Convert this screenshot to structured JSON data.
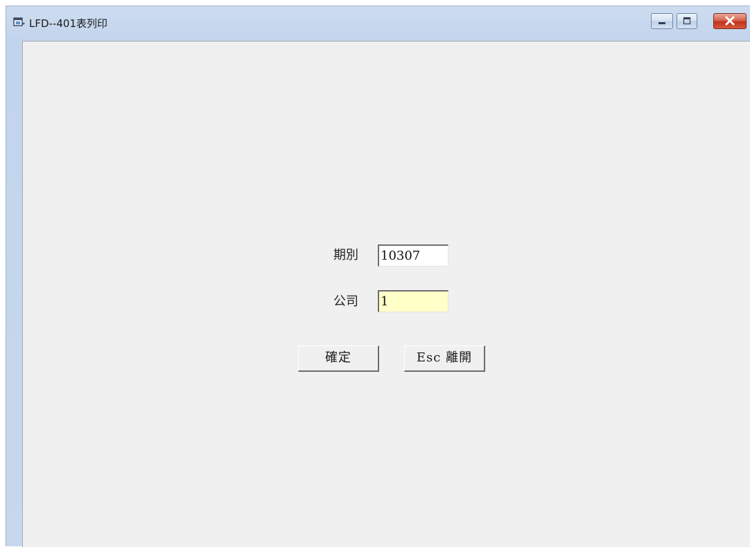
{
  "window": {
    "title": "LFD--401表列印"
  },
  "form": {
    "period": {
      "label": "期別",
      "value": "10307",
      "background": "#ffffff"
    },
    "company": {
      "label": "公司",
      "value": "1",
      "background": "#ffffc8"
    }
  },
  "buttons": {
    "confirm_label": "確定",
    "exit_label": "Esc 離開"
  },
  "colors": {
    "client_background": "#f0f0f0",
    "titlebar": "#c7d7ed",
    "close_button": "#c8402a"
  }
}
